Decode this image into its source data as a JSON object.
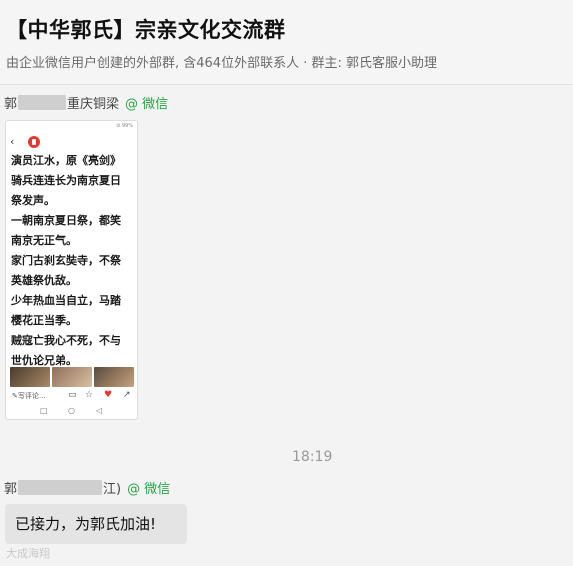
{
  "header": {
    "title": "【中华郭氏】宗亲文化交流群",
    "subtitle": "由企业微信用户创建的外部群, 含464位外部联系人 · 群主: 郭氏客服小助理"
  },
  "messages": [
    {
      "sender_prefix": "郭",
      "sender_suffix": "重庆铜梁",
      "platform": "@ 微信",
      "image": {
        "status_right": "⊘ 99%",
        "lines": [
          "演员江水，原《亮剑》",
          "骑兵连连长为南京夏日",
          "祭发声。",
          "一朝南京夏日祭，都笑",
          "南京无正气。",
          "家门古刹玄奘寺，不祭",
          "英雄祭仇敌。",
          "少年热血当自立，马踏",
          "樱花正当季。",
          "贼寇亡我心不死，不与",
          "世仇论兄弟。"
        ],
        "comment_label": "写评论..."
      }
    },
    {
      "time": "18:19"
    },
    {
      "sender_prefix": "郭",
      "sender_suffix": "江)",
      "platform": "@ 微信",
      "text": "已接力，为郭氏加油!"
    }
  ],
  "watermark": "大成海翔"
}
